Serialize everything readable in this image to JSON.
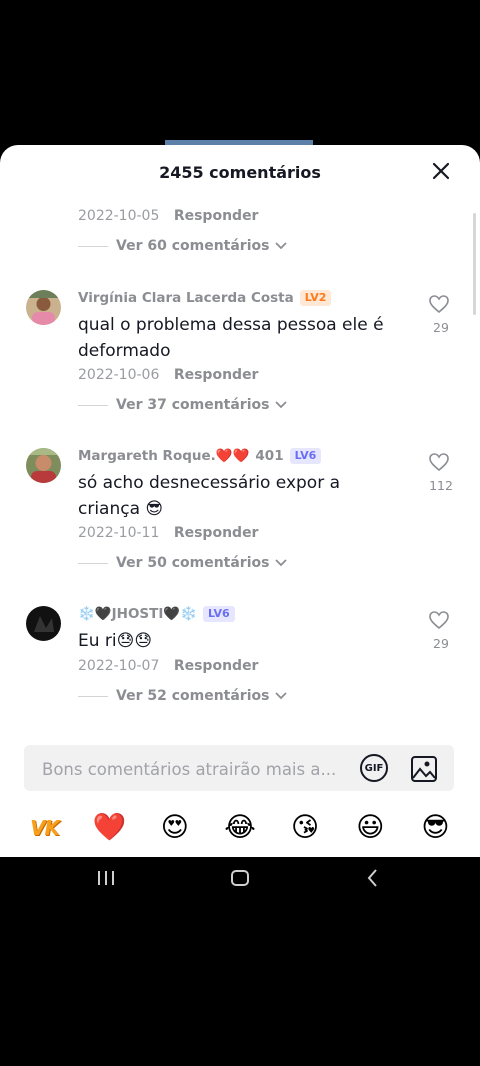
{
  "header": {
    "title": "2455 comentários",
    "close_icon": "close-icon"
  },
  "top_partial": {
    "date": "2022-10-05",
    "reply_label": "Responder",
    "replies_label": "Ver 60 comentários"
  },
  "comments": [
    {
      "username": "Virgínia Clara Lacerda Costa",
      "level": "LV2",
      "text": "qual o problema dessa pessoa ele é deformado",
      "date": "2022-10-06",
      "reply_label": "Responder",
      "replies_label": "Ver 37 comentários",
      "likes": "29"
    },
    {
      "username": "Margareth Roque.❤️❤️",
      "extra": "401",
      "level": "LV6",
      "text": "só  acho desnecessário  expor a criança  😎",
      "date": "2022-10-11",
      "reply_label": "Responder",
      "replies_label": "Ver 50 comentários",
      "likes": "112"
    },
    {
      "username": "❄️🖤JHOSTI🖤❄️",
      "level": "LV6",
      "text": "Eu ri😓😓",
      "date": "2022-10-07",
      "reply_label": "Responder",
      "replies_label": "Ver 52 comentários",
      "likes": "29"
    }
  ],
  "input": {
    "placeholder": "Bons comentários atrairão mais a...",
    "gif_label": "GIF"
  },
  "emoji_bar": {
    "vk_label": "VK",
    "emojis": [
      "❤️",
      "😍",
      "😂",
      "😘",
      "😃",
      "😎"
    ]
  },
  "colors": {
    "text_primary": "#161823",
    "text_secondary": "#8b8d92",
    "lv_orange": "#ff7a1a",
    "lv_purple": "#6a6ef5"
  }
}
